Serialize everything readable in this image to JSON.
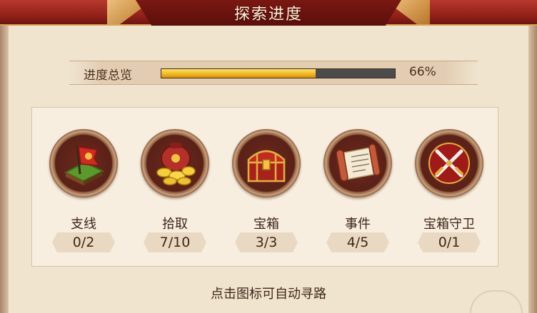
{
  "title": "探索进度",
  "overview": {
    "label": "进度总览",
    "progress": 0.66,
    "percent_text": "66%"
  },
  "items": [
    {
      "label": "支线",
      "count": "0/2",
      "icon": "flag-map-icon"
    },
    {
      "label": "拾取",
      "count": "7/10",
      "icon": "gold-bag-icon"
    },
    {
      "label": "宝箱",
      "count": "3/3",
      "icon": "treasure-chest-icon"
    },
    {
      "label": "事件",
      "count": "4/5",
      "icon": "scroll-icon"
    },
    {
      "label": "宝箱守卫",
      "count": "0/1",
      "icon": "crossed-swords-icon"
    }
  ],
  "hint": "点击图标可自动寻路",
  "colors": {
    "accent_red": "#8d1f18",
    "progress_gold": "#f0b41a",
    "panel_bg": "#f0e4cf"
  }
}
